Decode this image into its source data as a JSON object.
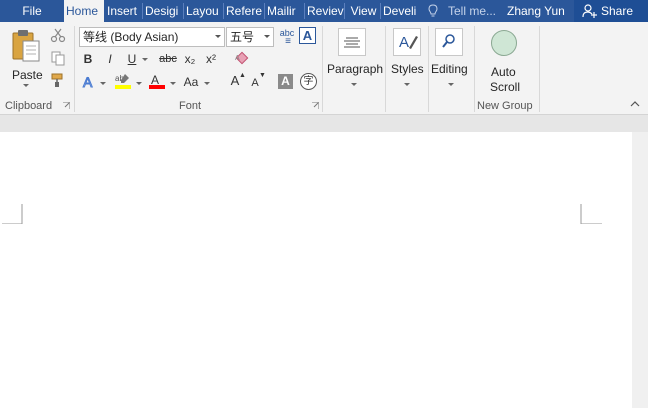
{
  "tabs": [
    {
      "label": "File",
      "active": false
    },
    {
      "label": "Home",
      "active": true
    },
    {
      "label": "Insert",
      "active": false
    },
    {
      "label": "Desigi",
      "active": false
    },
    {
      "label": "Layou",
      "active": false
    },
    {
      "label": "Refere",
      "active": false
    },
    {
      "label": "Mailir",
      "active": false
    },
    {
      "label": "Reviev",
      "active": false
    },
    {
      "label": "View",
      "active": false
    },
    {
      "label": "Develi",
      "active": false
    }
  ],
  "tell_me": "Tell me...",
  "user_name": "Zhang Yun",
  "share_label": "Share",
  "clipboard": {
    "paste_label": "Paste",
    "group_label": "Clipboard"
  },
  "font": {
    "font_name": "等线 (Body Asian)",
    "font_size": "五号",
    "group_label": "Font",
    "bold": "B",
    "italic": "I",
    "underline": "U",
    "strikethrough": "abc",
    "subscript": "x₂",
    "superscript": "x²",
    "change_case": "Aa",
    "grow": "A",
    "shrink": "A",
    "char_shading": "A",
    "enclose": "字",
    "clear_format_glyph": "abc",
    "text_box_glyph": "A"
  },
  "paragraph": {
    "label": "Paragraph"
  },
  "styles": {
    "label": "Styles"
  },
  "editing": {
    "label": "Editing"
  },
  "new_group": {
    "auto_label_1": "Auto",
    "auto_label_2": "Scroll",
    "group_label": "New Group"
  },
  "colors": {
    "brand": "#2b579a",
    "highlight": "#ffff00",
    "font_color": "#ff0000",
    "ribbon_bg": "#f3f3f3"
  }
}
